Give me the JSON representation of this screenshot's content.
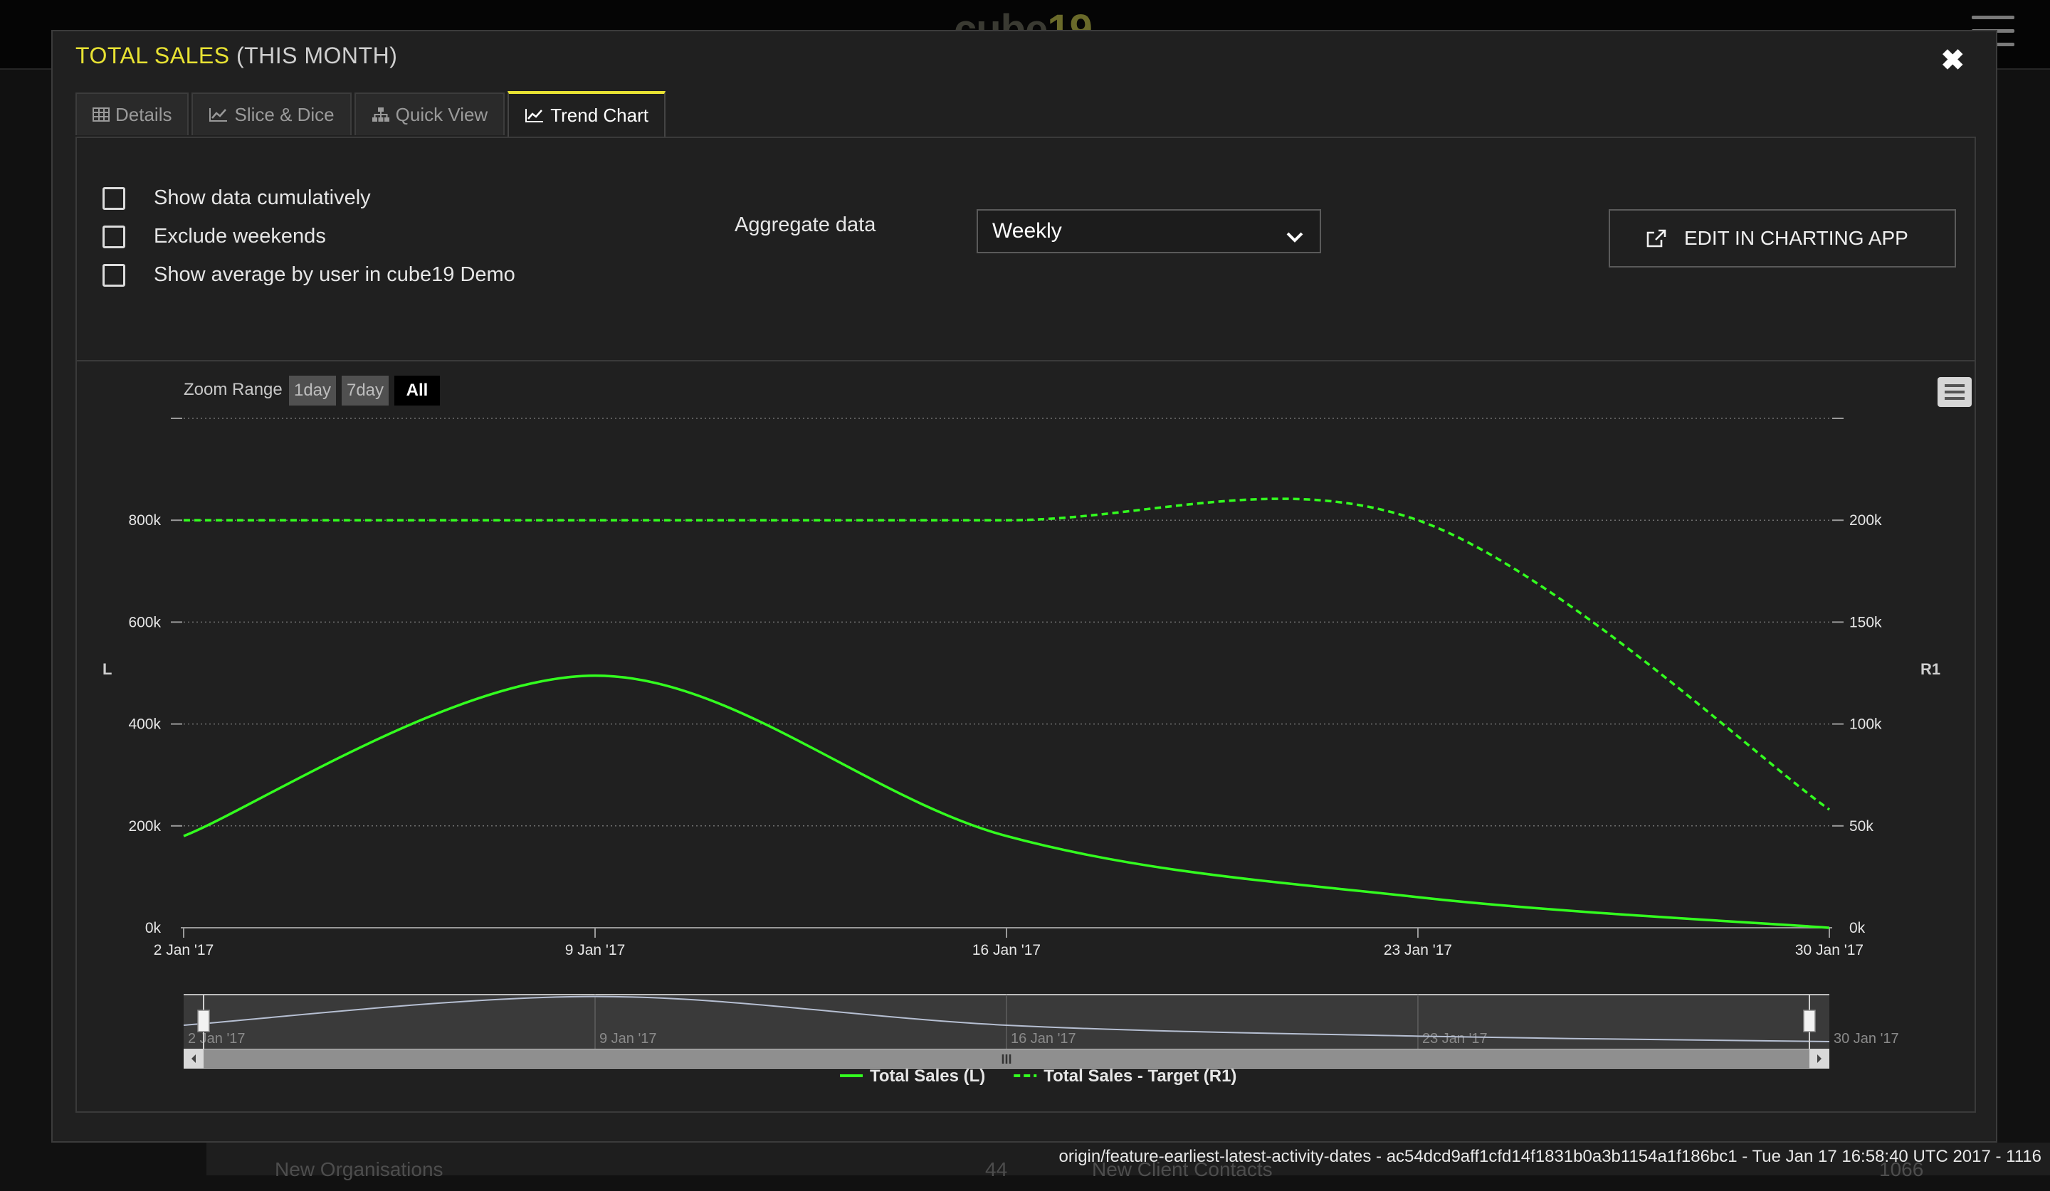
{
  "background": {
    "logo_text": "cube",
    "logo_accent": "19",
    "footer_items": [
      "New Organisations",
      "44",
      "New Client Contacts",
      "1066"
    ],
    "commit_info": "origin/feature-earliest-latest-activity-dates - ac54dcd9aff1cfd14f1831b0a3b1154a1f186bc1 - Tue Jan 17 16:58:40 UTC 2017 - 1116"
  },
  "modal": {
    "title_main": "TOTAL SALES",
    "title_sub": "(THIS MONTH)",
    "close_icon": "close-icon",
    "tabs": [
      {
        "label": "Details",
        "icon": "table-icon"
      },
      {
        "label": "Slice & Dice",
        "icon": "line-chart-icon"
      },
      {
        "label": "Quick View",
        "icon": "sitemap-icon"
      },
      {
        "label": "Trend Chart",
        "icon": "area-chart-icon",
        "active": true
      }
    ]
  },
  "options": {
    "checkboxes": [
      {
        "label": "Show data cumulatively",
        "checked": false
      },
      {
        "label": "Exclude weekends",
        "checked": false
      },
      {
        "label": "Show average by user in cube19 Demo",
        "checked": false
      }
    ],
    "aggregate_label": "Aggregate data",
    "aggregate_value": "Weekly",
    "edit_button": "EDIT IN CHARTING APP"
  },
  "zoom": {
    "label": "Zoom Range",
    "buttons": [
      {
        "label": "1day",
        "active": false
      },
      {
        "label": "7day",
        "active": false
      },
      {
        "label": "All",
        "active": true
      }
    ]
  },
  "colors": {
    "accent": "#e8e233",
    "series_line": "#33ff1f",
    "navigator_line": "#b6bfd2"
  },
  "chart_data": {
    "type": "line",
    "title": "",
    "left_axis": {
      "label": "L",
      "ticks": [
        "0k",
        "200k",
        "400k",
        "600k",
        "800k"
      ],
      "range": [
        0,
        1000000
      ]
    },
    "right_axis": {
      "label": "R1",
      "ticks": [
        "0k",
        "50k",
        "100k",
        "150k",
        "200k"
      ],
      "range": [
        0,
        250000
      ]
    },
    "x_ticks": [
      "2 Jan '17",
      "9 Jan '17",
      "16 Jan '17",
      "23 Jan '17",
      "30 Jan '17"
    ],
    "x_range": [
      "2017-01-02",
      "2017-01-30"
    ],
    "grid": true,
    "legend_position": "bottom-center",
    "series": [
      {
        "name": "Total Sales (L)",
        "axis": "left",
        "style": "solid",
        "points": [
          {
            "x": "2017-01-02",
            "y": 180000
          },
          {
            "x": "2017-01-09",
            "y": 495000
          },
          {
            "x": "2017-01-16",
            "y": 180000
          },
          {
            "x": "2017-01-23",
            "y": 60000
          },
          {
            "x": "2017-01-30",
            "y": 0
          }
        ]
      },
      {
        "name": "Total Sales - Target (R1)",
        "axis": "right",
        "style": "dashed",
        "points": [
          {
            "x": "2017-01-02",
            "y": 200000
          },
          {
            "x": "2017-01-09",
            "y": 200000
          },
          {
            "x": "2017-01-16",
            "y": 200000
          },
          {
            "x": "2017-01-23",
            "y": 200000
          },
          {
            "x": "2017-01-30",
            "y": 58000
          }
        ]
      }
    ],
    "navigator": {
      "x_ticks": [
        "2 Jan '17",
        "9 Jan '17",
        "16 Jan '17",
        "23 Jan '17",
        "30 Jan '17"
      ],
      "scroll_handle": "III"
    }
  }
}
